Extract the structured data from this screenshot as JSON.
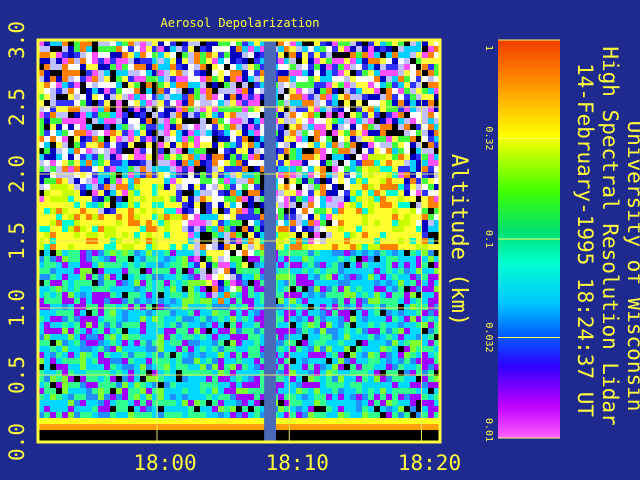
{
  "chart_data": {
    "type": "heatmap",
    "title": "Aerosol Depolarization",
    "ylabel": "Altitude (km)",
    "xlabel": "",
    "x_ticks": [
      "18:00",
      "18:10",
      "18:20"
    ],
    "x_tick_minutes": [
      -1,
      9,
      19
    ],
    "x_range_minutes": [
      -10,
      20.4
    ],
    "y_ticks": [
      "0.0",
      "0.5",
      "1.0",
      "1.5",
      "2.0",
      "2.5",
      "3.0"
    ],
    "y_tick_values": [
      0,
      0.5,
      1,
      1.5,
      2,
      2.5,
      3
    ],
    "ylim": [
      0,
      3
    ],
    "colorbar": {
      "scale": "log",
      "range": [
        0.01,
        1
      ],
      "tick_labels": [
        "1",
        "0.32",
        "0.1",
        "0.032",
        "0.01"
      ],
      "tick_values": [
        1,
        0.32,
        0.1,
        0.032,
        0.01
      ]
    },
    "data_gap_minutes": [
      7.1,
      8.0
    ],
    "grid": true
  },
  "header": {
    "institution": "University of Wisconsin",
    "instrument": "High Spectral Resolution Lidar",
    "timestamp": "14-February-1995 18:24:37 UT"
  },
  "colors": {
    "background": "#1e2a8e",
    "text": "#ffff3c",
    "grid": "#e8e860",
    "frame": "#ffff3c",
    "gap": "#4a6ab8"
  }
}
